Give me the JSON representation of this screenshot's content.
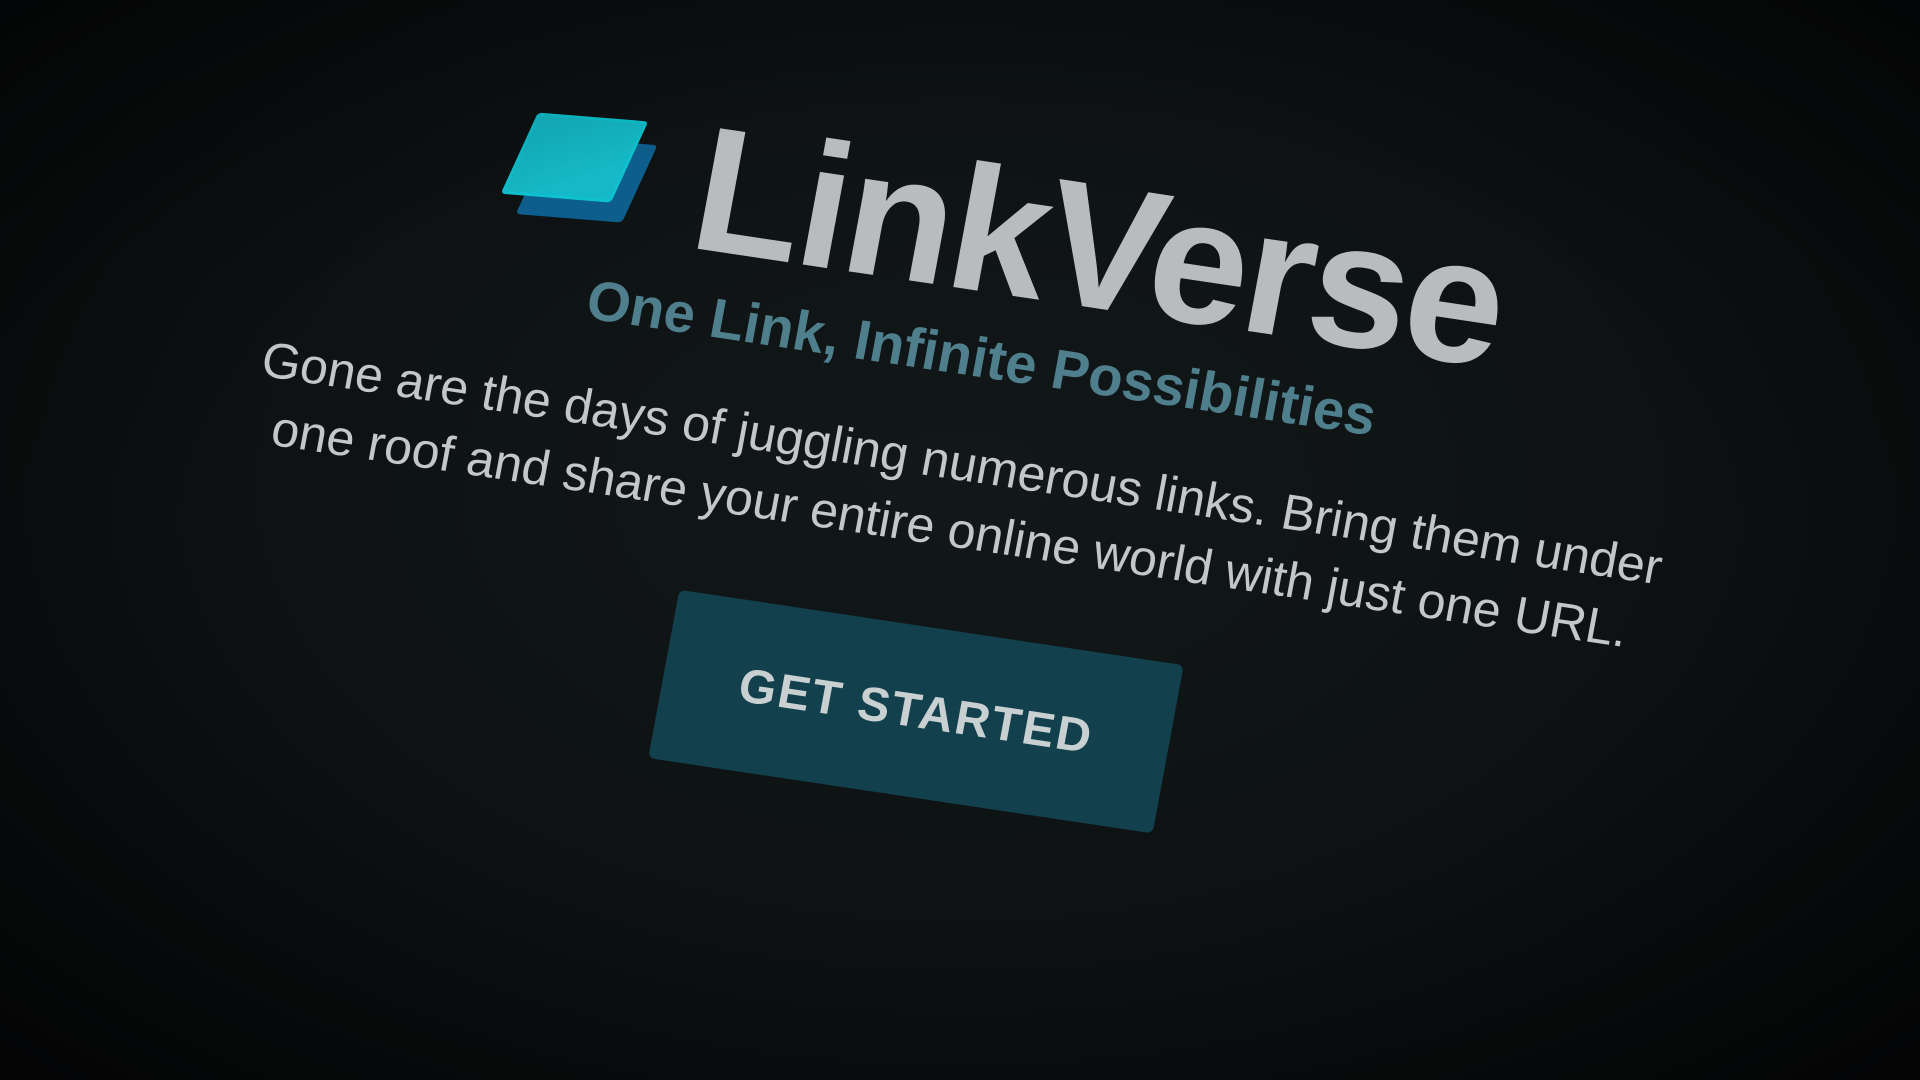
{
  "brand": {
    "name": "LinkVerse",
    "logo_icon": "layered-squares-logo",
    "logo_colors": [
      "#15b8c6",
      "#0d5e8c"
    ]
  },
  "hero": {
    "tagline": "One Link, Infinite Possibilities",
    "description": "Gone are the days of juggling numerous links. Bring them under one roof and share your entire online world with just one URL.",
    "cta_label": "GET STARTED"
  },
  "colors": {
    "background": "#0d1112",
    "brand_text": "#b9bcbd",
    "tagline_text": "#4f7f8c",
    "body_text": "#c4c6c7",
    "cta_background": "#12404c",
    "cta_text": "#c9d0d2"
  }
}
